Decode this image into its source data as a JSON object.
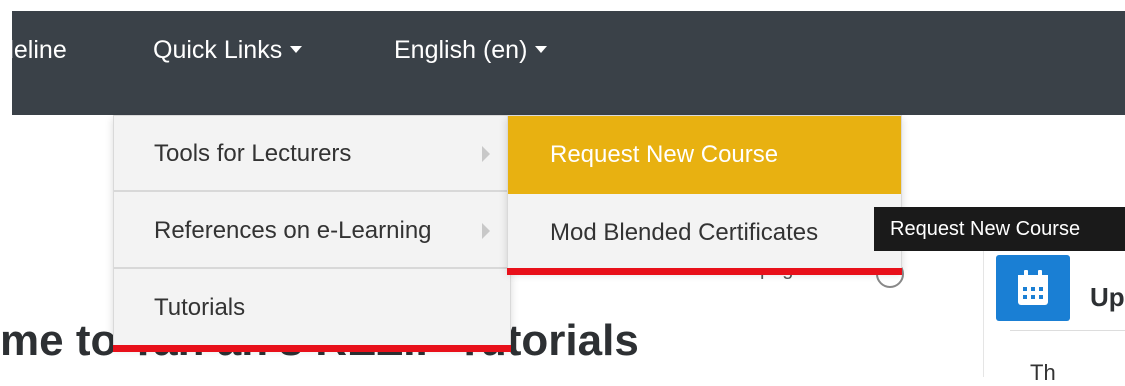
{
  "navbar": {
    "items": [
      {
        "label": "deline"
      },
      {
        "label": "Quick Links"
      },
      {
        "label": "English (en)"
      }
    ]
  },
  "dropdown": {
    "items": [
      {
        "label": "Tools for Lecturers"
      },
      {
        "label": "References on e-Learning"
      },
      {
        "label": "Tutorials"
      }
    ]
  },
  "submenu": {
    "items": [
      {
        "label": "Request New Course"
      },
      {
        "label": "Mod Blended Certificates"
      }
    ]
  },
  "tooltip": {
    "text": "Request New Course"
  },
  "page": {
    "heading": "me to Tan an's REZIP Tutorials",
    "fragment": "pag",
    "block_title": "Up",
    "block_text": "Th"
  },
  "colors": {
    "navbar_bg": "#3a4148",
    "submenu_active": "#e8b111",
    "highlight_red": "#e8101a",
    "calendar_icon_bg": "#1a7fd4"
  }
}
